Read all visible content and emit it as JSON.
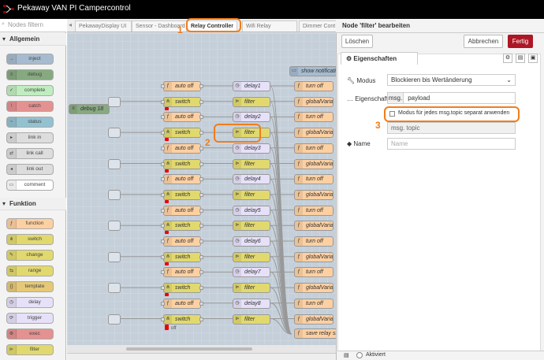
{
  "app": {
    "title": "Pekaway VAN PI Campercontrol"
  },
  "palette": {
    "search_placeholder": "Nodes filtern",
    "categories": [
      {
        "label": "Allgemein",
        "nodes": [
          {
            "label": "inject",
            "color": "#a6bbcf"
          },
          {
            "label": "debug",
            "color": "#87a980"
          },
          {
            "label": "complete",
            "color": "#c0edc0"
          },
          {
            "label": "catch",
            "color": "#e49191"
          },
          {
            "label": "status",
            "color": "#94c1d0"
          },
          {
            "label": "link in",
            "color": "#dddddd"
          },
          {
            "label": "link call",
            "color": "#dddddd"
          },
          {
            "label": "link out",
            "color": "#dddddd"
          },
          {
            "label": "comment",
            "color": "#ffffff"
          }
        ]
      },
      {
        "label": "Funktion",
        "nodes": [
          {
            "label": "function",
            "color": "#fdd0a2"
          },
          {
            "label": "switch",
            "color": "#e2d96e"
          },
          {
            "label": "change",
            "color": "#e2d96e"
          },
          {
            "label": "range",
            "color": "#e2d96e"
          },
          {
            "label": "template",
            "color": "#e6c978"
          },
          {
            "label": "delay",
            "color": "#e6e0f8"
          },
          {
            "label": "trigger",
            "color": "#e6e0f8"
          },
          {
            "label": "exec",
            "color": "#e49191"
          },
          {
            "label": "filter",
            "color": "#e2d96e"
          }
        ]
      }
    ]
  },
  "tabs": [
    {
      "label": "PekawayDisplay UI"
    },
    {
      "label": "Sensor - Dashboard"
    },
    {
      "label": "Relay Controller"
    },
    {
      "label": "Wifi Relay"
    },
    {
      "label": "Dimmer Cont"
    }
  ],
  "canvas": {
    "debug_node": "debug 18",
    "show_notification": "show notificati",
    "rows": [
      {
        "func": "auto off",
        "mid": "delay1",
        "out": "turn off"
      },
      {
        "func": "switch",
        "mid": "filter",
        "out": "globalVaria"
      },
      {
        "func": "auto off",
        "mid": "delay2",
        "out": "turn off"
      },
      {
        "func": "switch",
        "mid": "filter",
        "out": "globalVaria"
      },
      {
        "func": "auto off",
        "mid": "delay3",
        "out": "turn off"
      },
      {
        "func": "switch",
        "mid": "filter",
        "out": "globalVaria"
      },
      {
        "func": "auto off",
        "mid": "delay4",
        "out": "turn off"
      },
      {
        "func": "switch",
        "mid": "filter",
        "out": "globalVaria"
      },
      {
        "func": "auto off",
        "mid": "delay5",
        "out": "turn off"
      },
      {
        "func": "switch",
        "mid": "filter",
        "out": "globalVaria"
      },
      {
        "func": "auto off",
        "mid": "delay6",
        "out": "turn off"
      },
      {
        "func": "switch",
        "mid": "filter",
        "out": "globalVaria"
      },
      {
        "func": "auto off",
        "mid": "delay7",
        "out": "turn off"
      },
      {
        "func": "switch",
        "mid": "filter",
        "out": "globalVaria"
      },
      {
        "func": "auto off",
        "mid": "delay8",
        "out": "turn off"
      },
      {
        "func": "switch",
        "mid": "filter",
        "out": "globalVaria"
      }
    ],
    "save_relay": "save relay sta",
    "off_label": "off"
  },
  "editor": {
    "title": "Node 'filter' bearbeiten",
    "delete_label": "Löschen",
    "cancel_label": "Abbrechen",
    "done_label": "Fertig",
    "properties_tab": "Eigenschaften",
    "mode_label": "Modus",
    "mode_value": "Blockieren bis Wertänderung",
    "property_label": "Eigenschaft",
    "property_prefix": "msg.",
    "property_value": "payload",
    "checkbox_label": "Modus für jedes msg.topic separat anwenden",
    "topic_value": "msg. topic",
    "name_label": "Name",
    "name_placeholder": "Name",
    "status_label": "Aktiviert"
  },
  "annotations": [
    "1",
    "2",
    "3"
  ],
  "colors": {
    "accent": "#f07d1c",
    "done_button": "#ad1625",
    "topbar": "#000000",
    "function_node": "#fdd0a2",
    "switch_node": "#e2d96e",
    "delay_node": "#e6e0f8",
    "global_node": "#fdd0a2"
  }
}
